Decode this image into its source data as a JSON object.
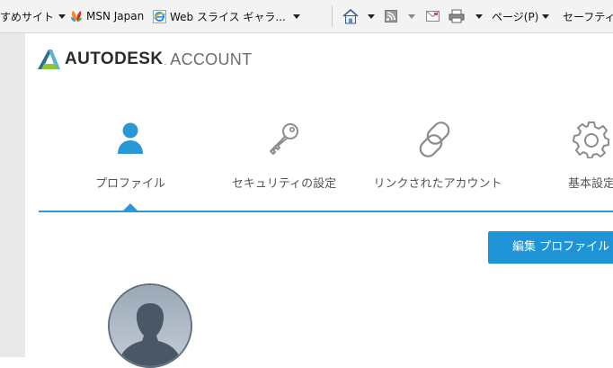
{
  "browser_toolbar": {
    "favorites": [
      {
        "label": "すめサイト",
        "icon": "suggested-sites-icon",
        "dropdown": true
      },
      {
        "label": "MSN Japan",
        "icon": "msn-butterfly-icon",
        "dropdown": false
      },
      {
        "label": "Web スライス ギャラ...",
        "icon": "ie-web-slice-icon",
        "dropdown": true
      }
    ],
    "commands": [
      {
        "label": "",
        "icon": "home-icon"
      },
      {
        "label": "",
        "icon": "rss-feed-icon"
      },
      {
        "label": "",
        "icon": "mail-icon"
      },
      {
        "label": "",
        "icon": "print-icon"
      },
      {
        "label": "ページ(P)",
        "icon": ""
      },
      {
        "label": "セーフティ",
        "icon": ""
      }
    ]
  },
  "header": {
    "brand_name": "AUTODESK",
    "brand_mark": ".",
    "brand_suffix": "ACCOUNT"
  },
  "tabs": [
    {
      "label": "プロファイル",
      "icon": "user-profile-icon",
      "active": true
    },
    {
      "label": "セキュリティの設定",
      "icon": "key-icon",
      "active": false
    },
    {
      "label": "リンクされたアカウント",
      "icon": "link-chain-icon",
      "active": false
    },
    {
      "label": "基本設定",
      "icon": "gear-icon",
      "active": false
    }
  ],
  "profile": {
    "edit_button_label": "編集 プロファイル",
    "avatar_icon": "default-avatar-icon"
  },
  "colors": {
    "accent": "#2a98d6",
    "button": "#1e94d7",
    "icon_gray": "#8c8c8c",
    "text": "#555555"
  }
}
